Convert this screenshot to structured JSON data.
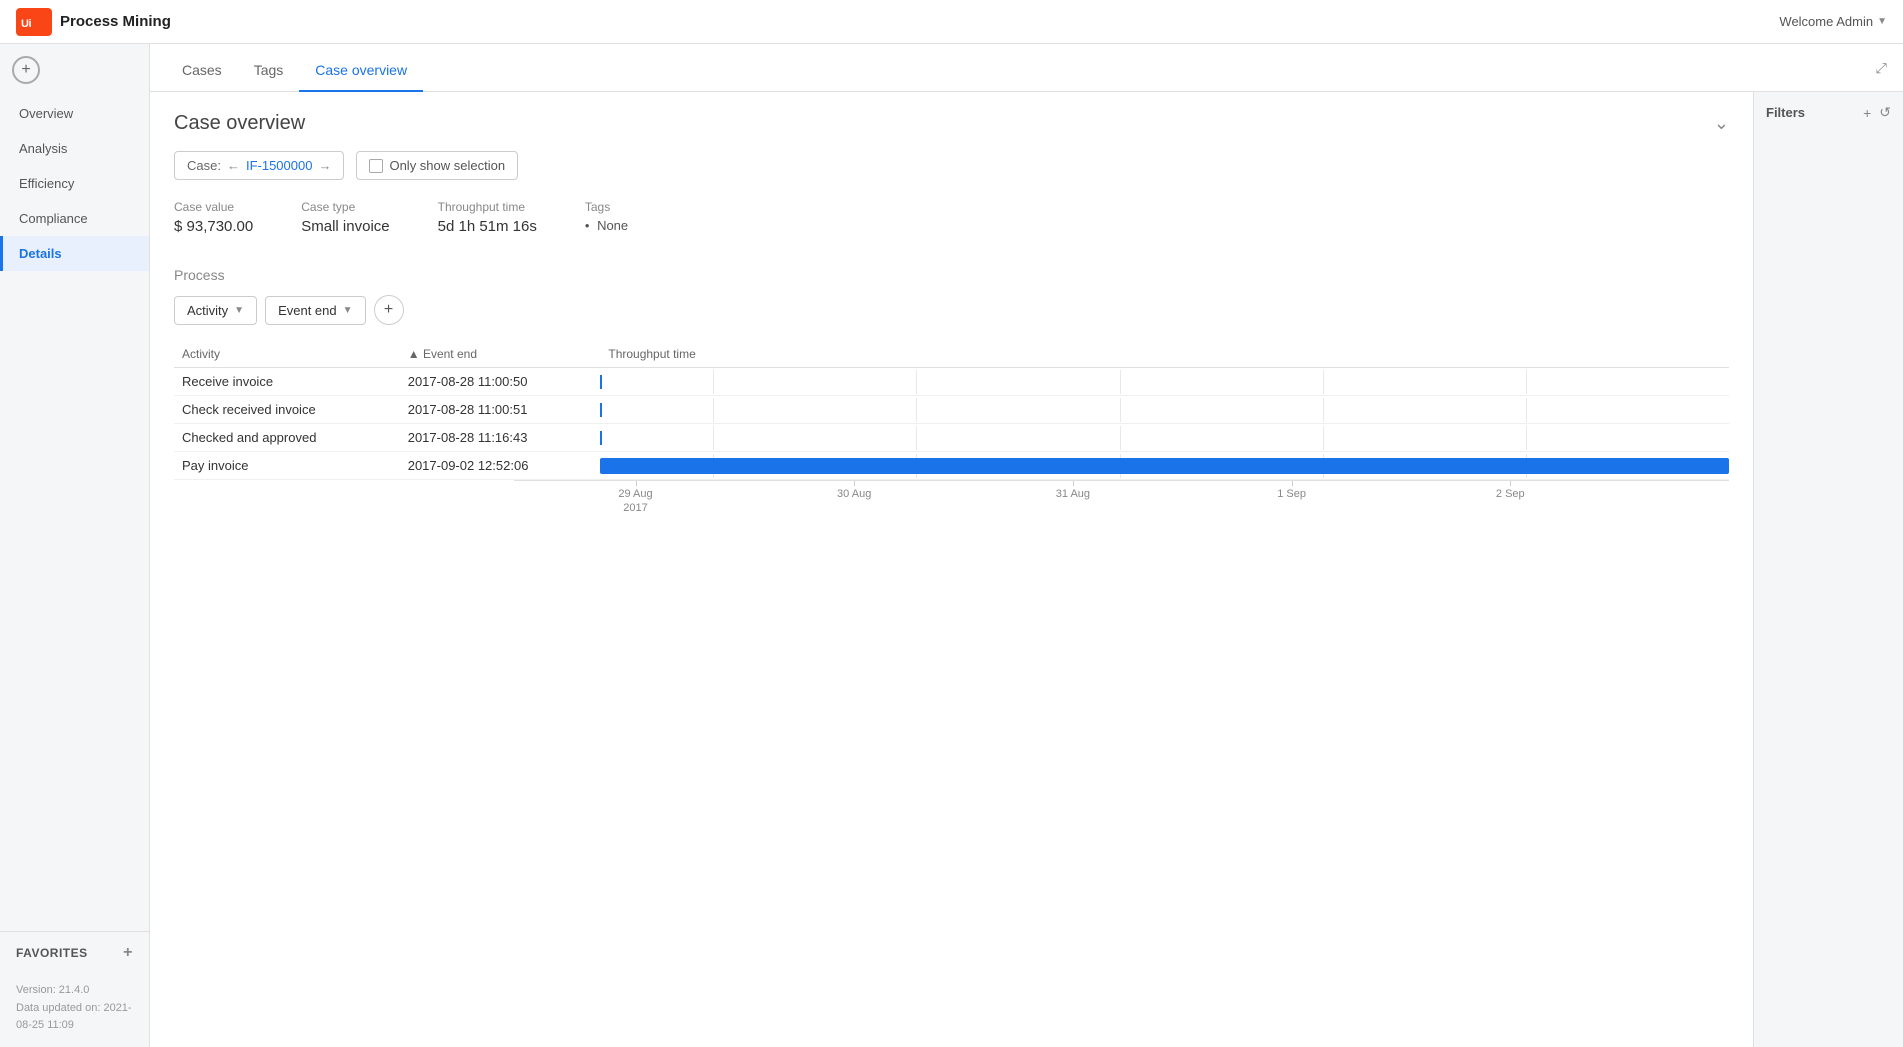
{
  "app": {
    "title": "Process Mining",
    "logo_text": "Ui",
    "welcome": "Welcome Admin"
  },
  "sidebar": {
    "nav_items": [
      {
        "id": "overview",
        "label": "Overview",
        "active": false
      },
      {
        "id": "analysis",
        "label": "Analysis",
        "active": false
      },
      {
        "id": "efficiency",
        "label": "Efficiency",
        "active": false
      },
      {
        "id": "compliance",
        "label": "Compliance",
        "active": false
      },
      {
        "id": "details",
        "label": "Details",
        "active": true
      }
    ],
    "favorites_label": "FAVORITES",
    "version": "Version: 21.4.0",
    "data_updated": "Data updated on: 2021-08-25 11:09"
  },
  "tabs": [
    {
      "id": "cases",
      "label": "Cases",
      "active": false
    },
    {
      "id": "tags",
      "label": "Tags",
      "active": false
    },
    {
      "id": "case-overview",
      "label": "Case overview",
      "active": true
    }
  ],
  "filters": {
    "title": "Filters"
  },
  "case_overview": {
    "title": "Case overview",
    "case_label": "Case:",
    "case_id": "IF-1500000",
    "show_selection_label": "Only show selection",
    "metrics": {
      "case_value_label": "Case value",
      "case_value": "$ 93,730.00",
      "case_type_label": "Case type",
      "case_type": "Small invoice",
      "throughput_label": "Throughput time",
      "throughput": "5d 1h 51m 16s",
      "tags_label": "Tags",
      "tags_value": "None"
    },
    "process_label": "Process",
    "columns": {
      "activity": "Activity",
      "event_end": "Event end",
      "throughput": "Throughput time"
    },
    "column_buttons": [
      {
        "label": "Activity"
      },
      {
        "label": "Event end"
      }
    ],
    "rows": [
      {
        "activity": "Receive invoice",
        "event_end": "2017-08-28 11:00:50",
        "bar_start_pct": 0,
        "bar_width_pct": 0.8,
        "is_tick": true
      },
      {
        "activity": "Check received invoice",
        "event_end": "2017-08-28 11:00:51",
        "bar_start_pct": 0,
        "bar_width_pct": 0.8,
        "is_tick": true
      },
      {
        "activity": "Checked and approved",
        "event_end": "2017-08-28 11:16:43",
        "bar_start_pct": 0,
        "bar_width_pct": 1.2,
        "is_tick": true
      },
      {
        "activity": "Pay invoice",
        "event_end": "2017-09-02 12:52:06",
        "bar_start_pct": 0,
        "bar_width_pct": 100,
        "is_tick": false
      }
    ],
    "timeline": {
      "labels": [
        {
          "label": "29 Aug\n2017",
          "pct": 10
        },
        {
          "label": "30 Aug",
          "pct": 28
        },
        {
          "label": "31 Aug",
          "pct": 46
        },
        {
          "label": "1 Sep",
          "pct": 64
        },
        {
          "label": "2 Sep",
          "pct": 82
        }
      ]
    }
  }
}
